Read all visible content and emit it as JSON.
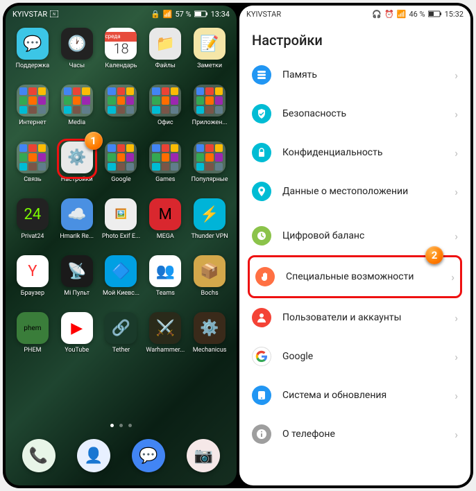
{
  "left": {
    "statusbar": {
      "carrier": "KYIVSTAR",
      "nfc": "NFC",
      "battery_pct": "57 %",
      "time": "13:34"
    },
    "apps": {
      "r1": [
        {
          "label": "Поддержка",
          "bg": "#3cc6e6",
          "glyph": "💬"
        },
        {
          "label": "Часы",
          "bg": "#222",
          "glyph": "🕐"
        },
        {
          "label": "Календарь",
          "calendar": true,
          "weekday": "среда",
          "day": "18"
        },
        {
          "label": "Файлы",
          "bg": "#e8e8e8",
          "glyph": "📁"
        },
        {
          "label": "Заметки",
          "bg": "#f5e6a8",
          "glyph": "📝"
        }
      ],
      "r2": [
        {
          "label": "Интернет",
          "folder": true
        },
        {
          "label": "Media",
          "folder": true
        },
        {
          "label": "",
          "folder": true
        },
        {
          "label": "Офис",
          "folder": true
        },
        {
          "label": "Приложен...",
          "folder": true
        }
      ],
      "r3": [
        {
          "label": "Связь",
          "folder": true
        },
        {
          "label": "Настройки",
          "bg": "#e8e8e8",
          "glyph": "⚙️",
          "highlight": true
        },
        {
          "label": "Google",
          "folder": true
        },
        {
          "label": "Games",
          "folder": true
        },
        {
          "label": "Популярные",
          "folder": true
        }
      ],
      "r4": [
        {
          "label": "Privat24",
          "bg": "#222",
          "glyph": "24",
          "text_color": "#7cfc00"
        },
        {
          "label": "Hmarik Re...",
          "bg": "#4a90e2",
          "glyph": "☁️"
        },
        {
          "label": "Photo Exif E...",
          "bg": "#eee",
          "glyph": "🖼️"
        },
        {
          "label": "MEGA",
          "bg": "#d9272e",
          "glyph": "M"
        },
        {
          "label": "Thunder VPN",
          "bg": "#00b4d8",
          "glyph": "⚡"
        }
      ],
      "r5": [
        {
          "label": "Браузер",
          "bg": "#fff",
          "glyph": "Y",
          "text_color": "#f33"
        },
        {
          "label": "Mi Пульт",
          "bg": "#1a1a1a",
          "glyph": "📡"
        },
        {
          "label": "Мой Киевс...",
          "bg": "#00a0e3",
          "glyph": "🔷"
        },
        {
          "label": "Teams",
          "bg": "#fff",
          "glyph": "👥",
          "text_color": "#5558af"
        },
        {
          "label": "Bochs",
          "bg": "#d4a84b",
          "glyph": "📦"
        }
      ],
      "r6": [
        {
          "label": "PHEM",
          "bg": "#3a7d3a",
          "glyph": "phem",
          "small": true
        },
        {
          "label": "YouTube",
          "bg": "#fff",
          "glyph": "▶",
          "text_color": "#f00"
        },
        {
          "label": "Tether",
          "bg": "#1a3a2a",
          "glyph": "🔗"
        },
        {
          "label": "Warhammer...",
          "bg": "#2a2a1a",
          "glyph": "⚔️"
        },
        {
          "label": "Mechanicus",
          "bg": "#3a2a1a",
          "glyph": "⚙️"
        }
      ]
    },
    "dock": [
      {
        "name": "phone",
        "bg": "#e8f5e8",
        "glyph": "📞"
      },
      {
        "name": "contacts",
        "bg": "#e8f0ff",
        "glyph": "👤"
      },
      {
        "name": "messages",
        "bg": "#4285f4",
        "glyph": "💬"
      },
      {
        "name": "camera",
        "bg": "#f5e8e8",
        "glyph": "📷"
      }
    ],
    "marker1": "1"
  },
  "right": {
    "statusbar": {
      "carrier": "KYIVSTAR",
      "battery_pct": "46 %",
      "time": "15:32"
    },
    "title": "Настройки",
    "items": [
      {
        "label": "Память",
        "color": "#2196f3",
        "icon": "storage"
      },
      {
        "label": "Безопасность",
        "color": "#00bcd4",
        "icon": "shield"
      },
      {
        "label": "Конфиденциальность",
        "color": "#00bcd4",
        "icon": "lock"
      },
      {
        "label": "Данные о местоположении",
        "color": "#00bcd4",
        "icon": "pin"
      },
      {
        "gap": true
      },
      {
        "label": "Цифровой баланс",
        "color": "#8bc34a",
        "icon": "balance"
      },
      {
        "label": "Специальные возможности",
        "color": "#ff7043",
        "icon": "hand",
        "highlight": true
      },
      {
        "label": "Пользователи и аккаунты",
        "color": "#f44336",
        "icon": "user"
      },
      {
        "label": "Google",
        "color": "#fff",
        "icon": "google",
        "border": true
      },
      {
        "label": "Система и обновления",
        "color": "#2196f3",
        "icon": "system"
      },
      {
        "label": "О телефоне",
        "color": "#9e9e9e",
        "icon": "info"
      }
    ],
    "marker2": "2"
  }
}
